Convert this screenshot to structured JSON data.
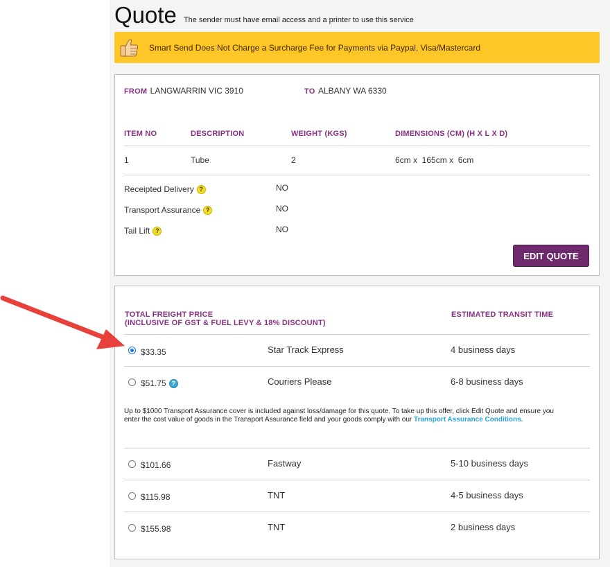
{
  "header": {
    "title": "Quote",
    "subtitle": "The sender must have email access and a printer to use this service"
  },
  "promo": {
    "icon": "thumbs-up-icon",
    "text": "Smart Send Does Not Charge a Surcharge Fee for Payments via Paypal, Visa/Mastercard",
    "color": "#fec627"
  },
  "route": {
    "from_label": "FROM",
    "from_value": "LANGWARRIN VIC 3910",
    "to_label": "TO",
    "to_value": "ALBANY WA 6330"
  },
  "items_table": {
    "headers": [
      "ITEM NO",
      "DESCRIPTION",
      "WEIGHT (KGS)",
      "DIMENSIONS (CM) (H X L X D)"
    ],
    "rows": [
      [
        "1",
        "Tube",
        "2",
        "6cm x  165cm x  6cm"
      ]
    ]
  },
  "options": [
    {
      "label": "Receipted Delivery",
      "value": "NO"
    },
    {
      "label": "Transport Assurance",
      "value": "NO"
    },
    {
      "label": "Tail Lift",
      "value": "NO"
    }
  ],
  "edit_button_label": "EDIT QUOTE",
  "prices": {
    "header_price_line1": "TOTAL FREIGHT PRICE",
    "header_price_line2": "(INCLUSIVE OF GST & FUEL LEVY & 18% DISCOUNT)",
    "header_transit": "ESTIMATED TRANSIT TIME",
    "rows": [
      {
        "price": "$33.35",
        "carrier": "Star Track Express",
        "transit": "4 business days",
        "selected": true
      },
      {
        "price": "$51.75",
        "carrier": "Couriers Please",
        "transit": "6-8 business days",
        "selected": false
      },
      {
        "price": "$101.66",
        "carrier": "Fastway",
        "transit": "5-10 business days",
        "selected": false
      },
      {
        "price": "$115.98",
        "carrier": "TNT",
        "transit": "4-5 business days",
        "selected": false
      },
      {
        "price": "$155.98",
        "carrier": "TNT",
        "transit": "2 business days",
        "selected": false
      }
    ],
    "note_text": "Up to $1000 Transport Assurance cover is included against loss/damage for this quote. To take up this offer, click Edit Quote and ensure you enter the cost value of goods in the Transport Assurance field and your goods comply with our",
    "note_link": "Transport Assurance Conditions",
    "note_end": "."
  },
  "colors": {
    "accent_purple": "#8a2f86",
    "button_purple": "#6f2a6e",
    "link_blue": "#29a3d9",
    "arrow_red": "#e8403a"
  }
}
